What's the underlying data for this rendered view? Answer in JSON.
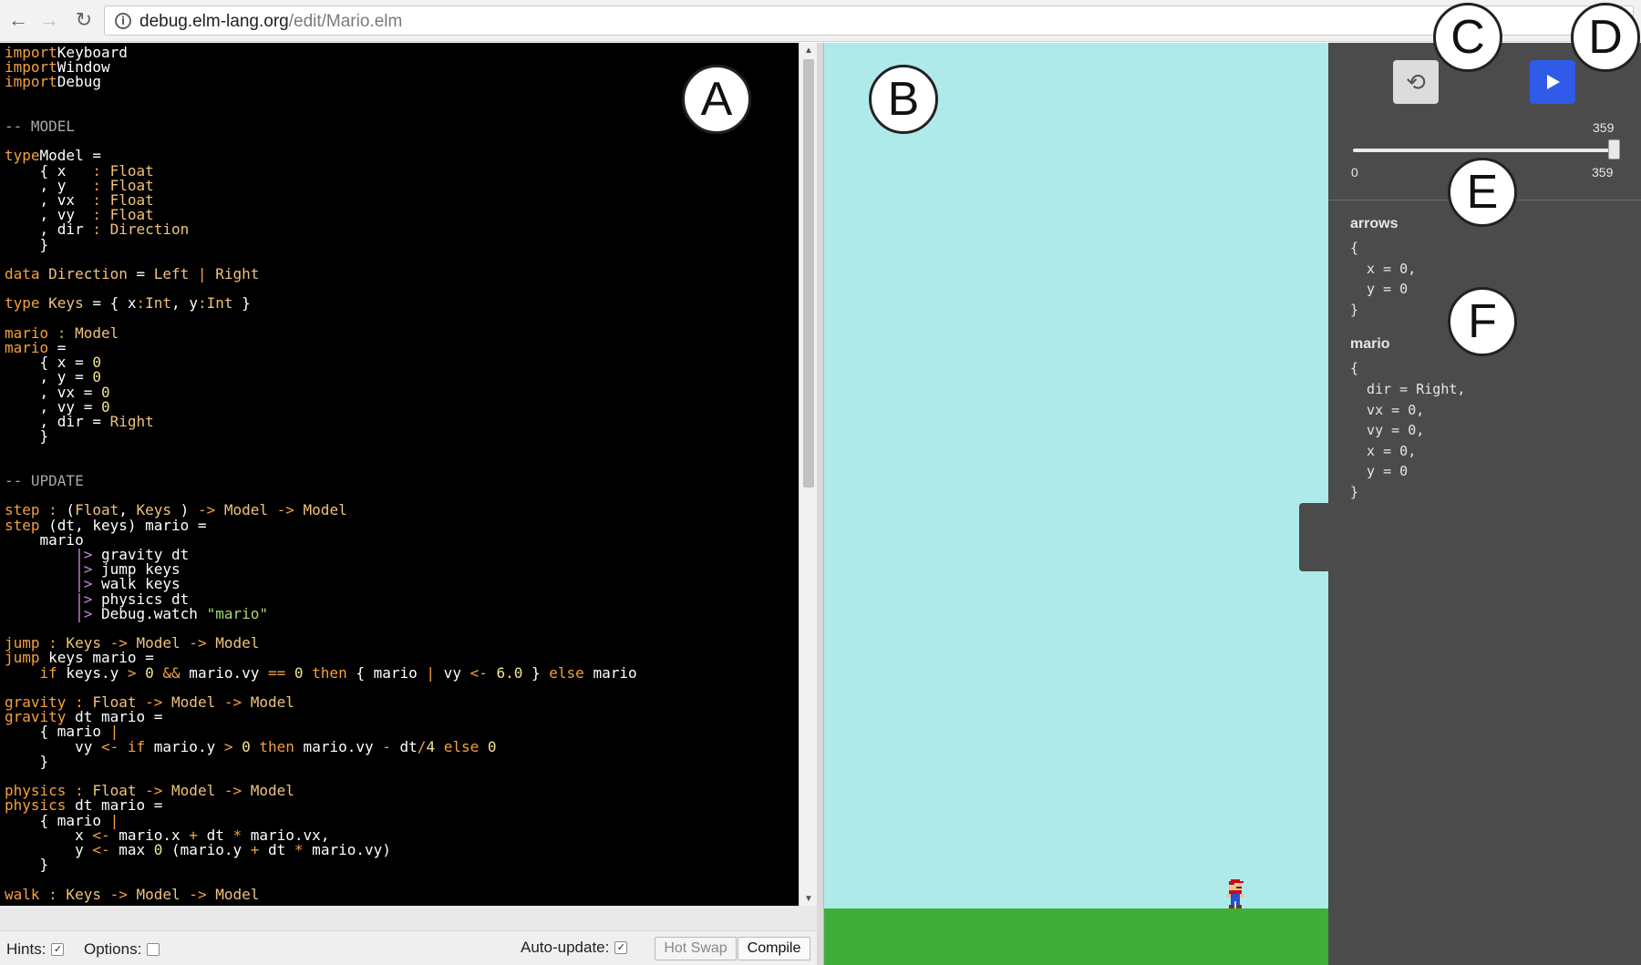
{
  "browser": {
    "url_domain": "debug.elm-lang.org",
    "url_path": "/edit/Mario.elm",
    "back_icon": "←",
    "forward_icon": "→",
    "reload_icon": "↻",
    "info_icon": "i"
  },
  "editor": {
    "lines": [
      [
        [
          "k",
          "import"
        ],
        [
          "",
          "Keyboard"
        ]
      ],
      [
        [
          "k",
          "import"
        ],
        [
          "",
          "Window"
        ]
      ],
      [
        [
          "k",
          "import"
        ],
        [
          "",
          "Debug"
        ]
      ],
      [],
      [],
      [
        [
          "c",
          "-- MODEL"
        ]
      ],
      [],
      [
        [
          "k",
          "type"
        ],
        [
          "",
          "Model ="
        ]
      ],
      [
        [
          "",
          "    { x   "
        ],
        [
          "k",
          ":"
        ],
        [
          "t",
          " Float"
        ]
      ],
      [
        [
          "",
          "    , y   "
        ],
        [
          "k",
          ":"
        ],
        [
          "t",
          " Float"
        ]
      ],
      [
        [
          "",
          "    , vx  "
        ],
        [
          "k",
          ":"
        ],
        [
          "t",
          " Float"
        ]
      ],
      [
        [
          "",
          "    , vy  "
        ],
        [
          "k",
          ":"
        ],
        [
          "t",
          " Float"
        ]
      ],
      [
        [
          "",
          "    , dir "
        ],
        [
          "k",
          ":"
        ],
        [
          "t",
          " Direction"
        ]
      ],
      [
        [
          "",
          "    }"
        ]
      ],
      [],
      [
        [
          "k",
          "data"
        ],
        [
          "t",
          " Direction"
        ],
        [
          "",
          " = "
        ],
        [
          "t",
          "Left"
        ],
        [
          "k",
          " |"
        ],
        [
          "t",
          " Right"
        ]
      ],
      [],
      [
        [
          "k",
          "type"
        ],
        [
          "t",
          " Keys"
        ],
        [
          "",
          " = { x"
        ],
        [
          "k",
          ":"
        ],
        [
          "t",
          "Int"
        ],
        [
          "",
          ", y"
        ],
        [
          "k",
          ":"
        ],
        [
          "t",
          "Int"
        ],
        [
          "",
          " }"
        ]
      ],
      [],
      [
        [
          "k",
          "mario"
        ],
        [
          "k",
          " :"
        ],
        [
          "t",
          " Model"
        ]
      ],
      [
        [
          "k",
          "mario"
        ],
        [
          "",
          " ="
        ]
      ],
      [
        [
          "",
          "    { x = "
        ],
        [
          "n",
          "0"
        ]
      ],
      [
        [
          "",
          "    , y = "
        ],
        [
          "n",
          "0"
        ]
      ],
      [
        [
          "",
          "    , vx = "
        ],
        [
          "n",
          "0"
        ]
      ],
      [
        [
          "",
          "    , vy = "
        ],
        [
          "n",
          "0"
        ]
      ],
      [
        [
          "",
          "    , dir = "
        ],
        [
          "t",
          "Right"
        ]
      ],
      [
        [
          "",
          "    }"
        ]
      ],
      [],
      [],
      [
        [
          "c",
          "-- UPDATE"
        ]
      ],
      [],
      [
        [
          "k",
          "step"
        ],
        [
          "k",
          " :"
        ],
        [
          "",
          " ("
        ],
        [
          "t",
          "Float"
        ],
        [
          "",
          ", "
        ],
        [
          "t",
          "Keys"
        ],
        [
          "",
          " ) "
        ],
        [
          "k",
          "->"
        ],
        [
          "t",
          " Model"
        ],
        [
          "k",
          " ->"
        ],
        [
          "t",
          " Model"
        ]
      ],
      [
        [
          "k",
          "step"
        ],
        [
          "",
          " (dt, keys) mario ="
        ]
      ],
      [
        [
          "",
          "    mario"
        ]
      ],
      [
        [
          "",
          "        "
        ],
        [
          "p",
          "|>"
        ],
        [
          "",
          " gravity dt"
        ]
      ],
      [
        [
          "",
          "        "
        ],
        [
          "p",
          "|>"
        ],
        [
          "",
          " jump keys"
        ]
      ],
      [
        [
          "",
          "        "
        ],
        [
          "p",
          "|>"
        ],
        [
          "",
          " walk keys"
        ]
      ],
      [
        [
          "",
          "        "
        ],
        [
          "p",
          "|>"
        ],
        [
          "",
          " physics dt"
        ]
      ],
      [
        [
          "",
          "        "
        ],
        [
          "p",
          "|>"
        ],
        [
          "",
          " Debug.watch "
        ],
        [
          "s",
          "\"mario\""
        ]
      ],
      [],
      [
        [
          "k",
          "jump"
        ],
        [
          "k",
          " :"
        ],
        [
          "t",
          " Keys"
        ],
        [
          "k",
          " ->"
        ],
        [
          "t",
          " Model"
        ],
        [
          "k",
          " ->"
        ],
        [
          "t",
          " Model"
        ]
      ],
      [
        [
          "k",
          "jump"
        ],
        [
          "",
          " keys mario ="
        ]
      ],
      [
        [
          "k",
          "    if"
        ],
        [
          "",
          " keys.y "
        ],
        [
          "k",
          ">"
        ],
        [
          "n",
          " 0"
        ],
        [
          "k",
          " &&"
        ],
        [
          "",
          " mario.vy "
        ],
        [
          "k",
          "=="
        ],
        [
          "n",
          " 0"
        ],
        [
          "k",
          " then"
        ],
        [
          "",
          " { mario "
        ],
        [
          "k",
          "|"
        ],
        [
          "",
          " vy "
        ],
        [
          "k",
          "<-"
        ],
        [
          "n",
          " 6.0"
        ],
        [
          "",
          " } "
        ],
        [
          "k",
          "else"
        ],
        [
          "",
          " mario"
        ]
      ],
      [],
      [
        [
          "k",
          "gravity"
        ],
        [
          "k",
          " :"
        ],
        [
          "t",
          " Float"
        ],
        [
          "k",
          " ->"
        ],
        [
          "t",
          " Model"
        ],
        [
          "k",
          " ->"
        ],
        [
          "t",
          " Model"
        ]
      ],
      [
        [
          "k",
          "gravity"
        ],
        [
          "",
          " dt mario ="
        ]
      ],
      [
        [
          "",
          "    { mario "
        ],
        [
          "k",
          "|"
        ]
      ],
      [
        [
          "",
          "        vy "
        ],
        [
          "k",
          "<-"
        ],
        [
          "k",
          " if"
        ],
        [
          "",
          " mario.y "
        ],
        [
          "k",
          ">"
        ],
        [
          "n",
          " 0"
        ],
        [
          "k",
          " then"
        ],
        [
          "",
          " mario.vy "
        ],
        [
          "k",
          "-"
        ],
        [
          "",
          " dt"
        ],
        [
          "k",
          "/"
        ],
        [
          "n",
          "4"
        ],
        [
          "k",
          " else"
        ],
        [
          "n",
          " 0"
        ]
      ],
      [
        [
          "",
          "    }"
        ]
      ],
      [],
      [
        [
          "k",
          "physics"
        ],
        [
          "k",
          " :"
        ],
        [
          "t",
          " Float"
        ],
        [
          "k",
          " ->"
        ],
        [
          "t",
          " Model"
        ],
        [
          "k",
          " ->"
        ],
        [
          "t",
          " Model"
        ]
      ],
      [
        [
          "k",
          "physics"
        ],
        [
          "",
          " dt mario ="
        ]
      ],
      [
        [
          "",
          "    { mario "
        ],
        [
          "k",
          "|"
        ]
      ],
      [
        [
          "",
          "        x "
        ],
        [
          "k",
          "<-"
        ],
        [
          "",
          " mario.x "
        ],
        [
          "k",
          "+"
        ],
        [
          "",
          " dt "
        ],
        [
          "k",
          "*"
        ],
        [
          "",
          " mario.vx,"
        ]
      ],
      [
        [
          "",
          "        y "
        ],
        [
          "k",
          "<-"
        ],
        [
          "",
          " max "
        ],
        [
          "n",
          "0"
        ],
        [
          "",
          " (mario.y "
        ],
        [
          "k",
          "+"
        ],
        [
          "",
          " dt "
        ],
        [
          "k",
          "*"
        ],
        [
          "",
          " mario.vy)"
        ]
      ],
      [
        [
          "",
          "    }"
        ]
      ],
      [],
      [
        [
          "k",
          "walk"
        ],
        [
          "k",
          " :"
        ],
        [
          "t",
          " Keys"
        ],
        [
          "k",
          " ->"
        ],
        [
          "t",
          " Model"
        ],
        [
          "k",
          " ->"
        ],
        [
          "t",
          " Model"
        ]
      ]
    ]
  },
  "bottom_bar": {
    "hints_label": "Hints:",
    "hints_checked": "✓",
    "options_label": "Options:",
    "autoupdate_label": "Auto-update:",
    "autoupdate_checked": "✓",
    "hotswap_label": "Hot Swap",
    "compile_label": "Compile"
  },
  "debugger": {
    "restart_icon": "⟲",
    "slider": {
      "current_label": "359",
      "min_label": "0",
      "max_label": "359",
      "position_fraction": 1.0
    },
    "watches": [
      {
        "name": "arrows",
        "value": "{\n  x = 0,\n  y = 0\n}"
      },
      {
        "name": "mario",
        "value": "{\n  dir = Right,\n  vx = 0,\n  vy = 0,\n  x = 0,\n  y = 0\n}"
      }
    ]
  },
  "annotations": {
    "a": "A",
    "b": "B",
    "c": "C",
    "d": "D",
    "e": "E",
    "f": "F"
  },
  "colors": {
    "sky": "#afeaea",
    "ground": "#3fad3a",
    "debugger_bg": "#4b4b4b",
    "play_button": "#2f5be8",
    "keyword": "#f5a13c"
  }
}
